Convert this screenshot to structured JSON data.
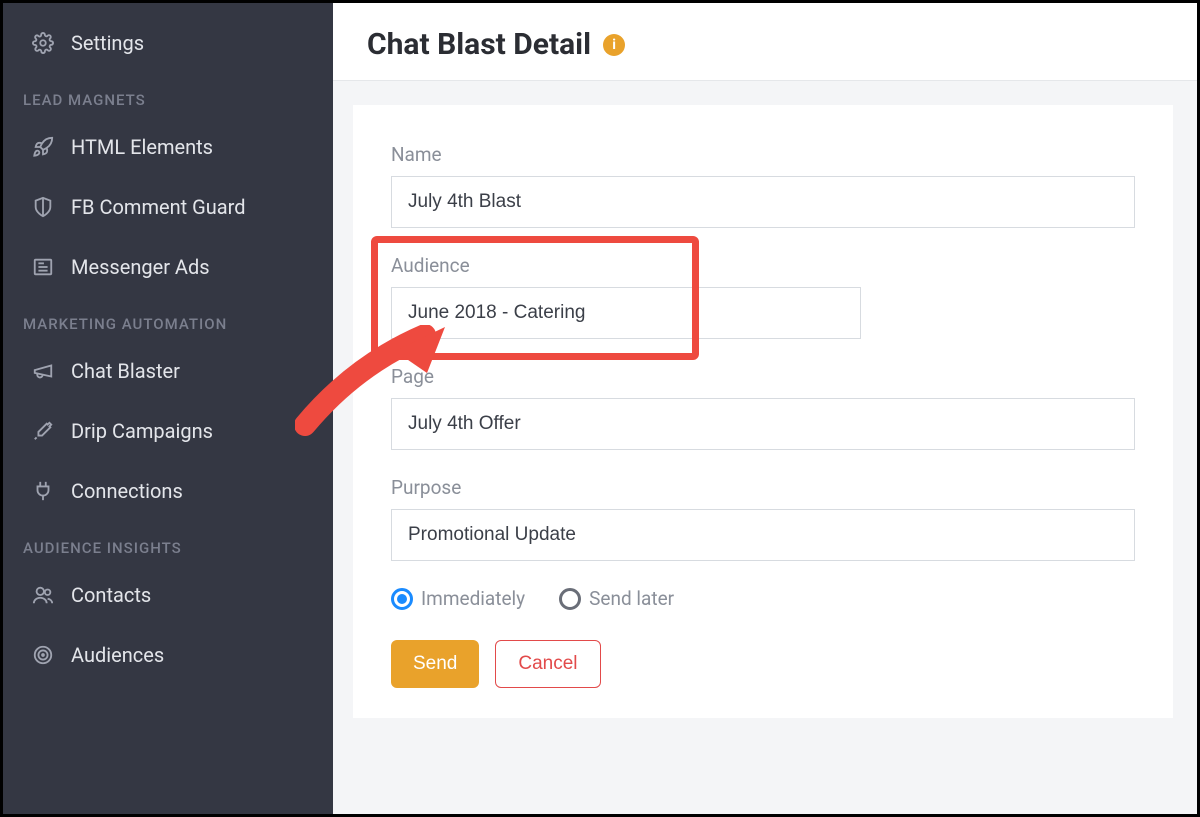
{
  "sidebar": {
    "top": {
      "settings": "Settings"
    },
    "sections": [
      {
        "label": "LEAD MAGNETS",
        "items": [
          {
            "id": "html-elements",
            "label": "HTML Elements",
            "icon": "rocket-icon"
          },
          {
            "id": "fb-comment-guard",
            "label": "FB Comment Guard",
            "icon": "shield-icon"
          },
          {
            "id": "messenger-ads",
            "label": "Messenger Ads",
            "icon": "newspaper-icon"
          }
        ]
      },
      {
        "label": "MARKETING AUTOMATION",
        "items": [
          {
            "id": "chat-blaster",
            "label": "Chat Blaster",
            "icon": "megaphone-icon"
          },
          {
            "id": "drip-campaigns",
            "label": "Drip Campaigns",
            "icon": "eyedropper-icon"
          },
          {
            "id": "connections",
            "label": "Connections",
            "icon": "plug-icon"
          }
        ]
      },
      {
        "label": "AUDIENCE INSIGHTS",
        "items": [
          {
            "id": "contacts",
            "label": "Contacts",
            "icon": "people-icon"
          },
          {
            "id": "audiences",
            "label": "Audiences",
            "icon": "target-icon"
          }
        ]
      }
    ]
  },
  "header": {
    "title": "Chat Blast Detail",
    "info_tooltip": "i"
  },
  "form": {
    "name": {
      "label": "Name",
      "value": "July 4th Blast"
    },
    "audience": {
      "label": "Audience",
      "value": "June 2018 - Catering"
    },
    "page": {
      "label": "Page",
      "value": "July 4th Offer"
    },
    "purpose": {
      "label": "Purpose",
      "value": "Promotional Update"
    },
    "timing": {
      "immediately": "Immediately",
      "send_later": "Send later",
      "selected": "immediately"
    },
    "actions": {
      "send": "Send",
      "cancel": "Cancel"
    }
  },
  "annotation": {
    "highlight_target": "audience",
    "arrow_color": "#ee4a3f"
  }
}
